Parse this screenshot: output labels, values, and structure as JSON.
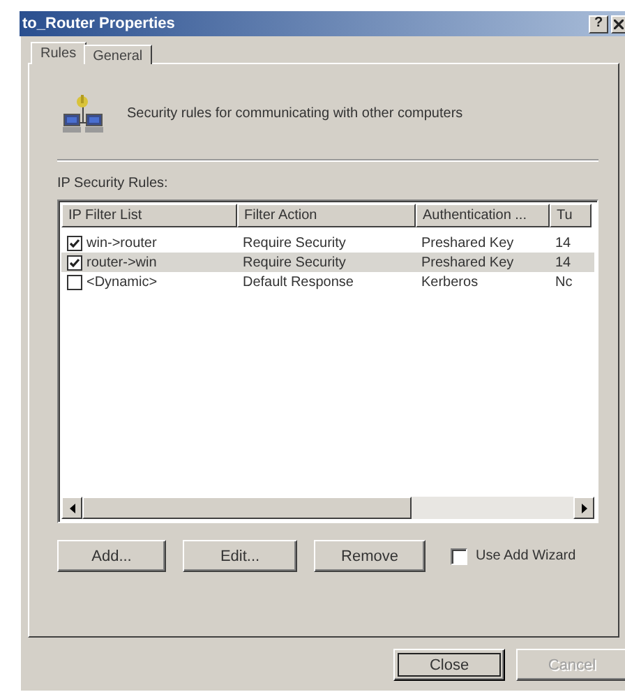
{
  "window": {
    "title": "to_Router Properties",
    "help": "?"
  },
  "tabs": [
    {
      "label": "Rules",
      "selected": true
    },
    {
      "label": "General",
      "selected": false
    }
  ],
  "description": "Security rules for communicating with other computers",
  "rules_label": "IP Security Rules:",
  "table": {
    "columns": [
      "IP Filter List",
      "Filter Action",
      "Authentication ...",
      "Tu"
    ],
    "rows": [
      {
        "checked": true,
        "selected": false,
        "cells": [
          "win->router",
          "Require Security",
          "Preshared Key",
          "14"
        ]
      },
      {
        "checked": true,
        "selected": true,
        "cells": [
          "router->win",
          "Require Security",
          "Preshared Key",
          "14"
        ]
      },
      {
        "checked": false,
        "selected": false,
        "cells": [
          "<Dynamic>",
          "Default Response",
          "Kerberos",
          "Nc"
        ]
      }
    ]
  },
  "actions": [
    {
      "label": "Add...",
      "disabled": false
    },
    {
      "label": "Edit...",
      "disabled": false
    },
    {
      "label": "Remove",
      "disabled": false
    }
  ],
  "wizard": {
    "label": "Use Add Wizard",
    "checked": false
  },
  "footer": [
    {
      "label": "Close",
      "disabled": false,
      "default": true
    },
    {
      "label": "Cancel",
      "disabled": true,
      "default": false
    }
  ]
}
